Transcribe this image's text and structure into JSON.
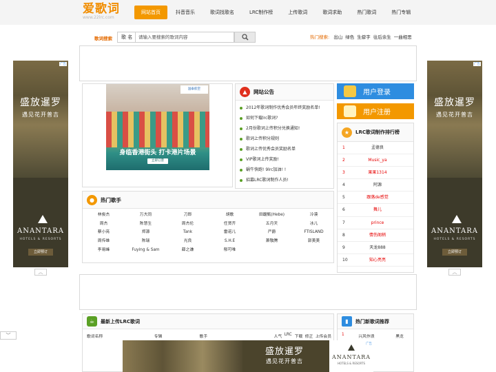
{
  "logo": {
    "text": "爱歌词",
    "url_text": "www.22lrc.com"
  },
  "nav": {
    "items": [
      "网站首页",
      "抖音音乐",
      "歌词找歌名",
      "LRC制作榜",
      "上传歌词",
      "歌词求助",
      "热门歌词",
      "热门专辑"
    ],
    "active_index": 0
  },
  "search": {
    "label": "歌词搜索",
    "select_value": "歌 名",
    "placeholder": "请输入要搜索的歌词内容"
  },
  "hot_search": {
    "label": "热门搜索:",
    "keywords": [
      "出山",
      "绿色",
      "生僻字",
      "往后余生",
      "一曲相思"
    ]
  },
  "side_ad": {
    "title": "盛放暹罗",
    "subtitle": "遇见花开普吉",
    "brand": "ANANTARA",
    "brand_sub": "HOTELS & RESORTS",
    "cta": "立即预订",
    "badge": "广告"
  },
  "square_ad": {
    "caption": "身临香港街头 打卡港片场景",
    "cta": "立即订票",
    "logo": "国泰航空",
    "badge": "广告"
  },
  "notice": {
    "title": "网站公告",
    "items": [
      "2012年歌词制作优秀会员年终奖励名单!",
      "如何下载lrc歌词?",
      "2月份歌词上传积分兑换通知!",
      "歌词上传积分规则",
      "歌词上传优秀会员奖励名单",
      "VIP歌词上传奖励!",
      "蜗牛快跑! 9lrc加油! !",
      "招募LRC歌词制作人员!"
    ]
  },
  "user": {
    "login": "用户登录",
    "register": "用户注册"
  },
  "rank": {
    "title": "LRC歌词制作排行榜",
    "items": [
      {
        "num": "1",
        "name": "孟德良",
        "color": "#333333"
      },
      {
        "num": "2",
        "name": "Music_ya",
        "color": "#e60000"
      },
      {
        "num": "3",
        "name": "果果1314",
        "color": "#e60000"
      },
      {
        "num": "4",
        "name": "阿源",
        "color": "#333333"
      },
      {
        "num": "5",
        "name": "跟落de感觉",
        "color": "#e60000"
      },
      {
        "num": "6",
        "name": "舞儿",
        "color": "#e60000"
      },
      {
        "num": "7",
        "name": "prince",
        "color": "#e60000"
      },
      {
        "num": "8",
        "name": "情伤阁稍",
        "color": "#e60000"
      },
      {
        "num": "9",
        "name": "天龙888",
        "color": "#333333"
      },
      {
        "num": "10",
        "name": "知心亮亮",
        "color": "#e60000"
      }
    ]
  },
  "singers": {
    "title": "热门歌手",
    "rows": [
      [
        "林俊杰",
        "万大同",
        "刀郎",
        "胡歌",
        "田馥甄(Hebe)",
        "冷漠"
      ],
      [
        "周杰",
        "陈慧生",
        "周杰伦",
        "任贤齐",
        "五月天",
        "冰儿"
      ],
      [
        "蔡小亮",
        "郑源",
        "Tank",
        "雷诺儿",
        "严爵",
        "FTISLAND"
      ],
      [
        "周传雄",
        "陈瑞",
        "光良",
        "S.H.E",
        "萧敬腾",
        "郭美美"
      ],
      [
        "李易峰",
        "Fuying & Sam",
        "薛之谦",
        "郁可唯",
        "",
        ""
      ]
    ]
  },
  "latest": {
    "title": "最新上传LRC歌词",
    "columns": [
      "歌词名称",
      "专辑",
      "歌手",
      "人气",
      "LRC",
      "下载",
      "修正",
      "上传会员"
    ]
  },
  "new_rec": {
    "title": "热门新歌词推荐",
    "items": [
      {
        "num": "1",
        "a": "兴风作浪",
        "b": "黑龙"
      }
    ]
  },
  "bottom_ad": {
    "title": "盛放暹罗",
    "subtitle": "遇见花开普吉",
    "brand": "ANANTARA",
    "brand_sub": "HOTELS & RESORTS",
    "badge": "广告"
  },
  "colors": {
    "accent": "#f39800",
    "blue": "#2e8de0",
    "red": "#e60000",
    "green": "#5aa024"
  }
}
